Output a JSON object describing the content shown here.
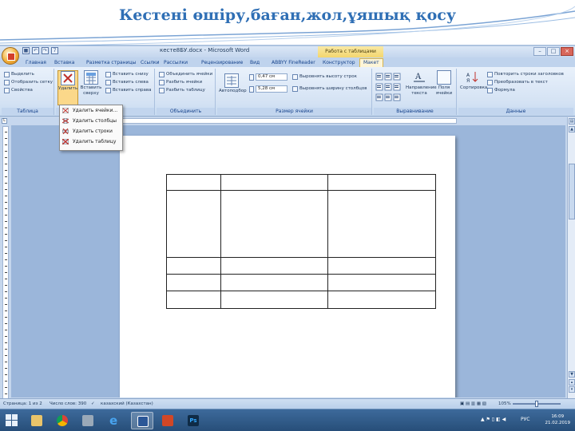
{
  "slide": {
    "title": "Кестені өшіру,баған,жол,ұяшық қосу"
  },
  "window": {
    "title": "кесте8БУ.docx - Microsoft Word",
    "context_tab_group": "Работа с таблицами",
    "qat_number": "7"
  },
  "tabs": [
    {
      "label": "Главная"
    },
    {
      "label": "Вставка"
    },
    {
      "label": "Разметка страницы"
    },
    {
      "label": "Ссылки"
    },
    {
      "label": "Рассылки"
    },
    {
      "label": "Рецензирование"
    },
    {
      "label": "Вид"
    },
    {
      "label": "ABBYY FineReader"
    },
    {
      "label": "Конструктор"
    },
    {
      "label": "Макет"
    }
  ],
  "ribbon": {
    "table_group": {
      "label": "Таблица",
      "items": [
        "Выделить",
        "Отобразить сетку",
        "Свойства"
      ]
    },
    "rows_cols_group": {
      "delete_label": "Удалить",
      "insert_above_label": "Вставить сверху",
      "items": [
        "Вставить снизу",
        "Вставить слева",
        "Вставить справа"
      ]
    },
    "merge_group": {
      "label": "Объединить",
      "items": [
        "Объединить ячейки",
        "Разбить ячейки",
        "Разбить таблицу"
      ]
    },
    "cell_size_group": {
      "label": "Размер ячейки",
      "autofit_label": "Автоподбор",
      "height_value": "0,47 см",
      "width_value": "5,28 см",
      "items": [
        "Выровнять высоту строк",
        "Выровнять ширину столбцов"
      ]
    },
    "alignment_group": {
      "label": "Выравнивание",
      "text_direction_label": "Направление текста",
      "margins_label": "Поля ячейки"
    },
    "data_group": {
      "label": "Данные",
      "sort_label": "Сортировка",
      "items": [
        "Повторить строки заголовков",
        "Преобразовать в текст",
        "Формула"
      ]
    }
  },
  "delete_menu": {
    "items": [
      "Удалить ячейки...",
      "Удалить столбцы",
      "Удалить строки",
      "Удалить таблицу"
    ]
  },
  "document": {
    "table": {
      "rows": 5,
      "cols": 3
    }
  },
  "statusbar": {
    "page": "Страница: 1 из 2",
    "words": "Число слов: 390",
    "language": "казахский (Казахстан)",
    "zoom": "105%"
  },
  "taskbar": {
    "tray_lang": "РУС",
    "time": "16:09",
    "date": "21.02.2019"
  },
  "colors": {
    "title": "#2f6fb5",
    "ribbon": "#d5e3f4",
    "taskbar": "#274e79"
  }
}
